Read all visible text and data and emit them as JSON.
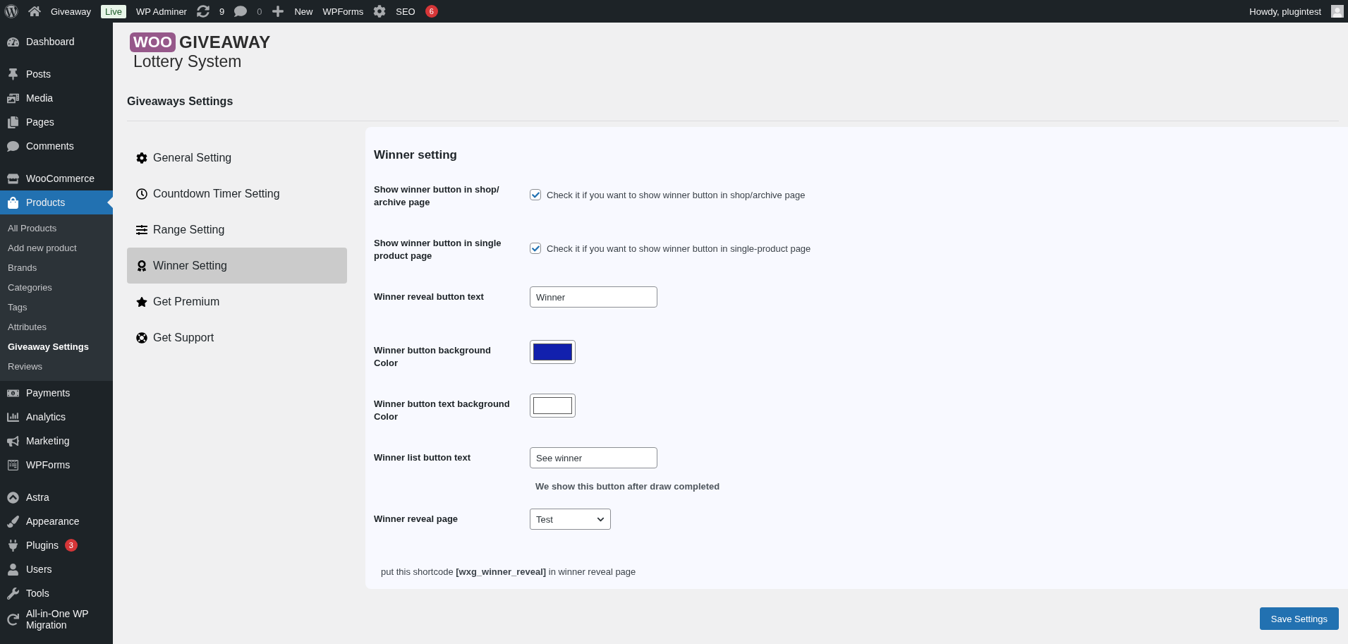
{
  "admin_bar": {
    "items": [
      {
        "kind": "site",
        "label": "Giveaway",
        "badge": "Live"
      },
      {
        "kind": "link",
        "label": "WP Adminer"
      },
      {
        "kind": "updates",
        "label": "9"
      },
      {
        "kind": "comments",
        "label": "0"
      },
      {
        "kind": "new",
        "label": "New"
      },
      {
        "kind": "link",
        "label": "WPForms"
      },
      {
        "kind": "seo",
        "label": "SEO",
        "badge": "6"
      }
    ],
    "greeting": "Howdy, plugintest"
  },
  "sidebar": {
    "groups": [
      [
        {
          "label": "Dashboard",
          "selected": false
        }
      ],
      [
        {
          "label": "Posts",
          "selected": false
        },
        {
          "label": "Media",
          "selected": false
        },
        {
          "label": "Pages",
          "selected": false
        },
        {
          "label": "Comments",
          "selected": false
        }
      ],
      [
        {
          "label": "WooCommerce",
          "selected": false
        },
        {
          "label": "Products",
          "selected": true,
          "children": [
            {
              "label": "All Products",
              "selected": false
            },
            {
              "label": "Add new product",
              "selected": false
            },
            {
              "label": "Brands",
              "selected": false
            },
            {
              "label": "Categories",
              "selected": false
            },
            {
              "label": "Tags",
              "selected": false
            },
            {
              "label": "Attributes",
              "selected": false
            },
            {
              "label": "Giveaway Settings",
              "selected": true
            },
            {
              "label": "Reviews",
              "selected": false
            }
          ]
        },
        {
          "label": "Payments",
          "selected": false
        },
        {
          "label": "Analytics",
          "selected": false
        },
        {
          "label": "Marketing",
          "selected": false
        },
        {
          "label": "WPForms",
          "selected": false
        }
      ],
      [
        {
          "label": "Astra",
          "selected": false
        },
        {
          "label": "Appearance",
          "selected": false
        },
        {
          "label": "Plugins",
          "selected": false,
          "badge": "3"
        },
        {
          "label": "Users",
          "selected": false
        },
        {
          "label": "Tools",
          "selected": false
        },
        {
          "label": "All-in-One WP Migration",
          "selected": false
        }
      ]
    ]
  },
  "logo": {
    "badge": "WOO",
    "title": "GIVEAWAY",
    "subtitle": "Lottery System"
  },
  "page_title": "Giveaways Settings",
  "tabs": [
    {
      "label": "General Setting",
      "selected": false
    },
    {
      "label": "Countdown Timer Setting",
      "selected": false
    },
    {
      "label": "Range Setting",
      "selected": false
    },
    {
      "label": "Winner Setting",
      "selected": true
    },
    {
      "label": "Get Premium",
      "selected": false
    },
    {
      "label": "Get Support",
      "selected": false
    }
  ],
  "panel": {
    "title": "Winner setting",
    "rows": [
      {
        "kind": "checkbox",
        "label": "Show winner button in shop/ archive page",
        "checked": true,
        "description": "Check it if you want to show winner button in shop/archive page"
      },
      {
        "kind": "checkbox",
        "label": "Show winner button in single product page",
        "checked": true,
        "description": "Check it if you want to show winner button in single-product page"
      },
      {
        "kind": "text",
        "label": "Winner reveal button text",
        "value": "Winner"
      },
      {
        "kind": "color",
        "label": "Winner button background Color",
        "color": "#1220ad"
      },
      {
        "kind": "color",
        "label": "Winner button text background Color",
        "color": "#ffffff"
      },
      {
        "kind": "text",
        "label": "Winner list button text",
        "value": "See winner",
        "note": "We show this button after draw completed"
      },
      {
        "kind": "select",
        "label": "Winner reveal page",
        "value": "Test"
      }
    ],
    "footer": "put this shortcode **[wxg_winner_reveal]** in winner reveal page"
  },
  "save_button": "Save Settings"
}
